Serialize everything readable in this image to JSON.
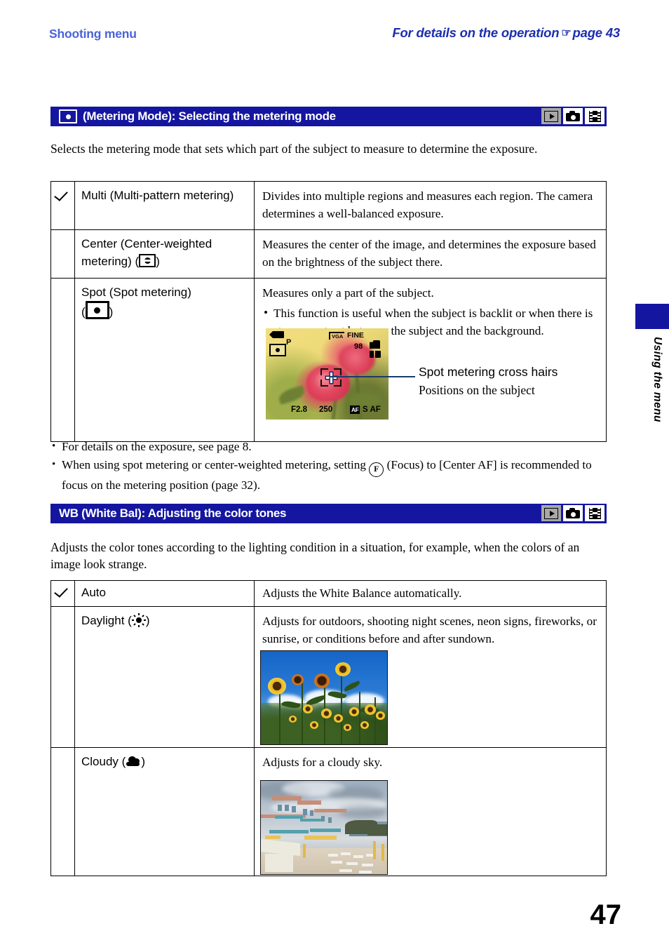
{
  "running_head": {
    "left": "Shooting menu",
    "right": "For details on the operation",
    "hand_icon": "pointing-hand-icon",
    "page_ref": "page 43"
  },
  "sections": [
    {
      "id": "metering",
      "bar_icon": "spot-metering-icon",
      "title": "(Metering Mode): Selecting the metering mode",
      "modes": [
        {
          "name": "playback-mode-icon",
          "state": "dimmed"
        },
        {
          "name": "still-camera-mode-icon",
          "state": "active"
        },
        {
          "name": "movie-mode-icon",
          "state": "active"
        }
      ],
      "intro": "Selects the metering mode that sets which part of the subject to measure to determine the exposure.",
      "rows": [
        {
          "checked": true,
          "label": "Multi (Multi-pattern metering)",
          "desc": "Divides into multiple regions and measures each region. The camera determines a well-balanced exposure."
        },
        {
          "checked": false,
          "label_pre": "Center (Center-weighted metering) (",
          "label_icon": "center-weighted-metering-icon",
          "label_post": ")",
          "desc": "Measures the center of the image, and determines the exposure based on the brightness of the subject there."
        },
        {
          "checked": false,
          "label_pre": "Spot (Spot metering)",
          "label_icon": "spot-metering-icon",
          "label_open": "(",
          "label_post": ")",
          "desc_main": "Measures only a part of the subject.",
          "desc_bullet": "This function is useful when the subject is backlit or when there is strong contrast between the subject and the background."
        }
      ],
      "lcd": {
        "battery": "battery-icon",
        "mode": "P",
        "metering": "spot-metering-icon",
        "image_size": "VGA",
        "quality": "FINE",
        "shots_remaining": "98",
        "media": "memory-card-icon",
        "folder": "folder-icon",
        "aperture": "F2.8",
        "shutter": "250",
        "af_badge": "AF",
        "af_mode": "S AF",
        "crosshair": "spot-metering-crosshair"
      },
      "callout": {
        "title": "Spot metering cross hairs",
        "subtitle": "Positions on the subject"
      },
      "notes": [
        "For details on the exposure, see page 8.",
        "When using spot metering or center-weighted metering, setting (Focus) to [Center AF] is recommended to focus on the metering position (page 32)."
      ],
      "note2_parts": {
        "pre": "When using spot metering or center-weighted metering, setting ",
        "icon": "focus-icon",
        "post": " (Focus) to [Center AF] is recommended to focus on the metering position (page 32)."
      }
    },
    {
      "id": "whitebalance",
      "title": "WB (White Bal): Adjusting the color tones",
      "modes": [
        {
          "name": "playback-mode-icon",
          "state": "dimmed"
        },
        {
          "name": "still-camera-mode-icon",
          "state": "active"
        },
        {
          "name": "movie-mode-icon",
          "state": "active"
        }
      ],
      "intro": "Adjusts the color tones according to the lighting condition in a situation, for example, when the colors of an image look strange.",
      "rows": [
        {
          "checked": true,
          "label": "Auto",
          "desc": "Adjusts the White Balance automatically."
        },
        {
          "checked": false,
          "label_pre": "Daylight (",
          "label_icon": "sun-icon",
          "label_post": ")",
          "desc": "Adjusts for outdoors, shooting night scenes, neon signs, fireworks, or sunrise, or conditions before and after sundown.",
          "photo": "sunflower-field-photo"
        },
        {
          "checked": false,
          "label_pre": "Cloudy (",
          "label_icon": "cloud-icon",
          "label_post": ")",
          "desc": "Adjusts for a cloudy sky.",
          "photo": "seaside-resort-photo"
        }
      ]
    }
  ],
  "side_tab": {
    "label": "Using the menu"
  },
  "folio": "47",
  "colors": {
    "header_blue_light": "#4a63d8",
    "header_blue_dark": "#1c2fae",
    "bar_blue": "#1516a0",
    "text_black": "#000000"
  }
}
